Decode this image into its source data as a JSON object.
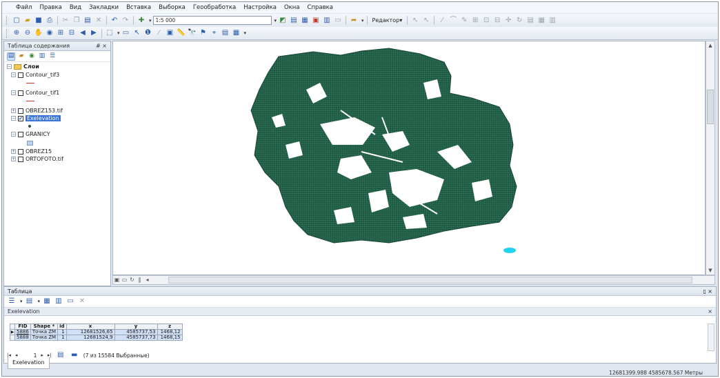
{
  "menu": [
    "Файл",
    "Правка",
    "Вид",
    "Закладки",
    "Вставка",
    "Выборка",
    "Геообработка",
    "Настройка",
    "Окна",
    "Справка"
  ],
  "toolbar": {
    "scale_value": "1:5 000",
    "editor_label": "Редактор▾"
  },
  "toc": {
    "title": "Таблица содержания",
    "pin": "# ×",
    "root_label": "Слои",
    "layers": [
      {
        "label": "Contour_tif3",
        "checked": false
      },
      {
        "label": "Contour_tif1",
        "checked": false
      },
      {
        "label": "OBREZ153.tif",
        "checked": false
      },
      {
        "label": "Exelevation",
        "checked": true,
        "selected": true
      },
      {
        "label": "GRANICY",
        "checked": false
      },
      {
        "label": "OBREZ15",
        "checked": false
      },
      {
        "label": "ORTOFOTO.tif",
        "checked": false
      }
    ]
  },
  "table": {
    "title": "Таблица",
    "title_controls": "▯ ×",
    "layer_name": "Exelevation",
    "close": "×",
    "columns": [
      "FID",
      "Shape *",
      "id",
      "x",
      "y",
      "z"
    ],
    "rows": [
      [
        "5886",
        "Точка ZM",
        "1",
        "12681526,65",
        "4585737,53",
        "1468,12"
      ],
      [
        "5888",
        "Точка ZM",
        "1",
        "12681524,9",
        "4585737,73",
        "1468,15"
      ]
    ],
    "nav_page": "1",
    "selection_text": "(7 из 15584 Выбранные)",
    "tab_label": "Exelevation"
  },
  "status": {
    "coords": "12681399.988  4585678.567 Метры"
  },
  "colors": {
    "point_fill": "#1f5a43",
    "highlight": "#22d3ee",
    "selection": "#3875d7"
  }
}
